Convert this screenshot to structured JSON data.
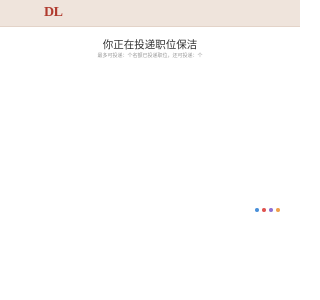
{
  "header": {
    "logo_text": "DL",
    "background": "#efe4dc",
    "logo_color": "#b03a2e"
  },
  "main": {
    "title": "你正在投递职位保洁",
    "subtitle": "最多可投递：个名额已投递职位，还可投递：个"
  },
  "loading_dots": {
    "colors": [
      "#4a90d9",
      "#e0534f",
      "#8e6fd1",
      "#f0a04b"
    ]
  }
}
